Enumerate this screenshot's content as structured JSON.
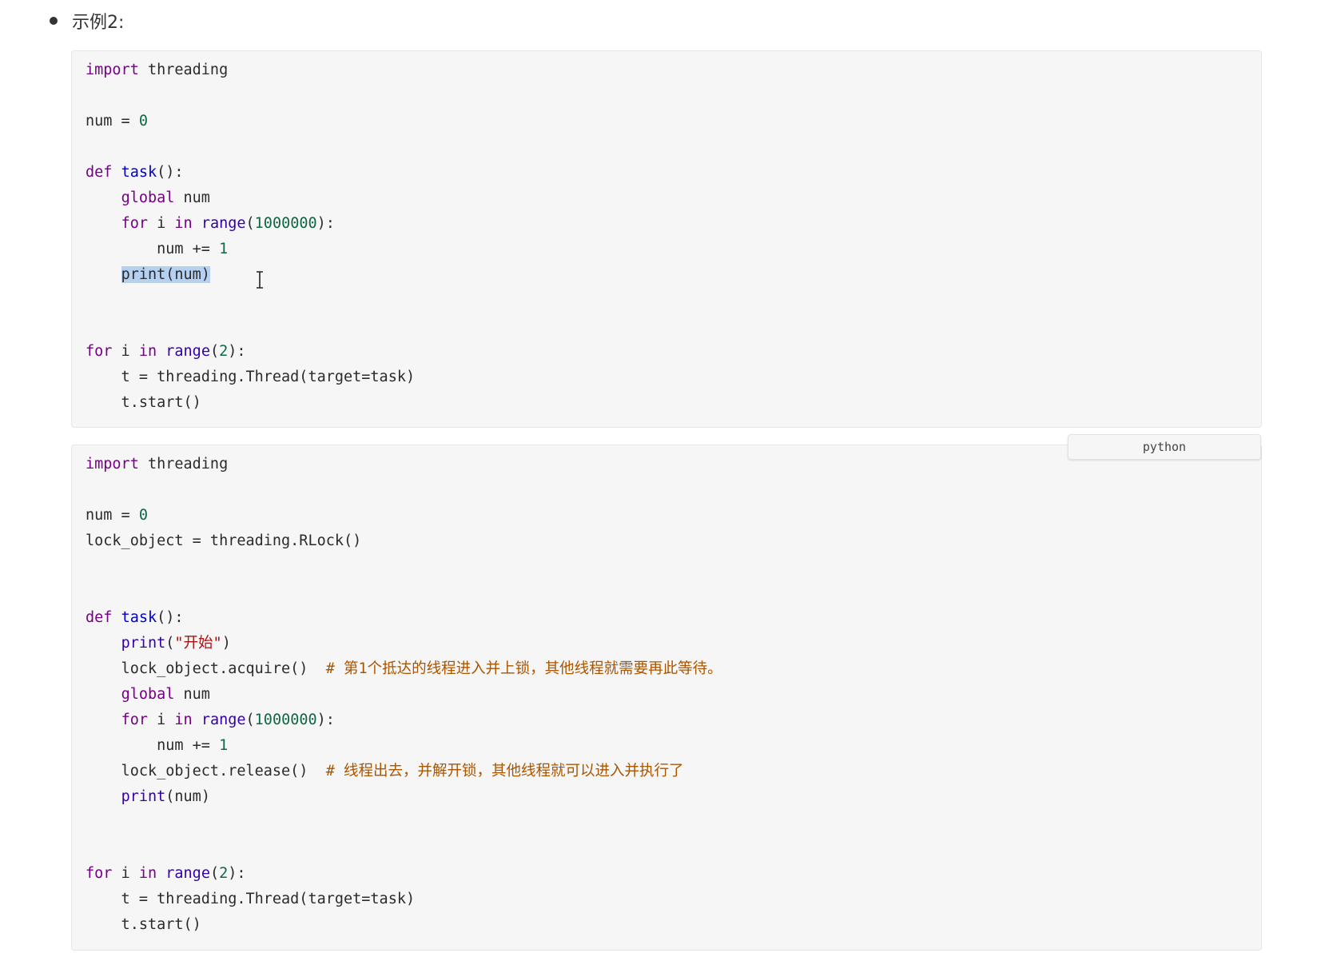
{
  "heading": {
    "text": "示例2:"
  },
  "block1": {
    "lines": {
      "l1": {
        "kw": "import",
        "rest": " threading"
      },
      "l3": {
        "a": "num = ",
        "n": "0"
      },
      "l5": {
        "kw": "def",
        "sp": " ",
        "fn": "task",
        "rest": "():"
      },
      "l6": {
        "indent": "    ",
        "kw": "global",
        "rest": " num"
      },
      "l7": {
        "indent": "    ",
        "kw1": "for",
        "mid1": " i ",
        "kw2": "in",
        "sp": " ",
        "bi": "range",
        "open": "(",
        "n": "1000000",
        "close": "):"
      },
      "l8": {
        "indent": "        ",
        "a": "num += ",
        "n": "1"
      },
      "l9": {
        "indent": "    ",
        "sel": "print(num)"
      },
      "l12": {
        "kw1": "for",
        "mid1": " i ",
        "kw2": "in",
        "sp": " ",
        "bi": "range",
        "open": "(",
        "n": "2",
        "close": "):"
      },
      "l13": {
        "text": "    t = threading.Thread(target=task)"
      },
      "l14": {
        "text": "    t.start()"
      }
    }
  },
  "block2": {
    "lang_label": "python",
    "lines": {
      "l1": {
        "kw": "import",
        "rest": " threading"
      },
      "l3": {
        "a": "num = ",
        "n": "0"
      },
      "l4": {
        "text": "lock_object = threading.RLock()"
      },
      "l7": {
        "kw": "def",
        "sp": " ",
        "fn": "task",
        "rest": "():"
      },
      "l8": {
        "indent": "    ",
        "bi": "print",
        "open": "(",
        "str": "\"开始\"",
        "close": ")"
      },
      "l9": {
        "code": "    lock_object.acquire()  ",
        "cm": "# 第1个抵达的线程进入并上锁，其他线程就需要再此等待。"
      },
      "l10": {
        "indent": "    ",
        "kw": "global",
        "rest": " num"
      },
      "l11": {
        "indent": "    ",
        "kw1": "for",
        "mid1": " i ",
        "kw2": "in",
        "sp": " ",
        "bi": "range",
        "open": "(",
        "n": "1000000",
        "close": "):"
      },
      "l12": {
        "indent": "        ",
        "a": "num += ",
        "n": "1"
      },
      "l13": {
        "code": "    lock_object.release()  ",
        "cm": "# 线程出去，并解开锁，其他线程就可以进入并执行了"
      },
      "l14": {
        "indent": "    ",
        "bi": "print",
        "rest": "(num)"
      },
      "l17": {
        "kw1": "for",
        "mid1": " i ",
        "kw2": "in",
        "sp": " ",
        "bi": "range",
        "open": "(",
        "n": "2",
        "close": "):"
      },
      "l18": {
        "text": "    t = threading.Thread(target=task)"
      },
      "l19": {
        "text": "    t.start()"
      }
    }
  },
  "colors": {
    "keyword": "#770088",
    "function_def": "#0000cc",
    "number": "#116644",
    "string": "#aa1111",
    "comment": "#aa5500",
    "builtin": "#3300aa",
    "selection": "#b4d0f2",
    "code_background": "#f6f6f6"
  },
  "icons": {
    "cursor": "text-cursor-ibeam-icon"
  }
}
